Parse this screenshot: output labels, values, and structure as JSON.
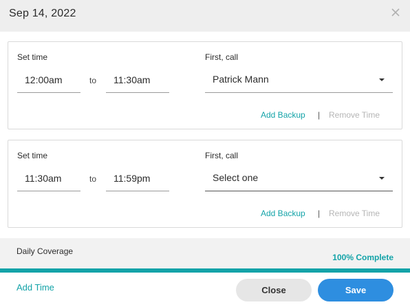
{
  "header": {
    "title": "Sep 14, 2022",
    "close_icon": "close-icon"
  },
  "shifts": [
    {
      "set_time_label": "Set time",
      "start": "12:00am",
      "to_label": "to",
      "end": "11:30am",
      "first_call_label": "First, call",
      "first_call_value": "Patrick Mann",
      "add_backup": "Add Backup",
      "separator": "|",
      "remove_time": "Remove Time"
    },
    {
      "set_time_label": "Set time",
      "start": "11:30am",
      "to_label": "to",
      "end": "11:59pm",
      "first_call_label": "First, call",
      "first_call_value": "Select one",
      "add_backup": "Add Backup",
      "separator": "|",
      "remove_time": "Remove Time"
    }
  ],
  "coverage": {
    "label": "Daily Coverage",
    "status": "100% Complete",
    "progress": 1.0
  },
  "footer": {
    "add_time": "Add Time",
    "close": "Close",
    "save": "Save"
  },
  "colors": {
    "accent": "#13a3a8",
    "primary": "#2e8ee0",
    "header_bg": "#eeeeee"
  }
}
